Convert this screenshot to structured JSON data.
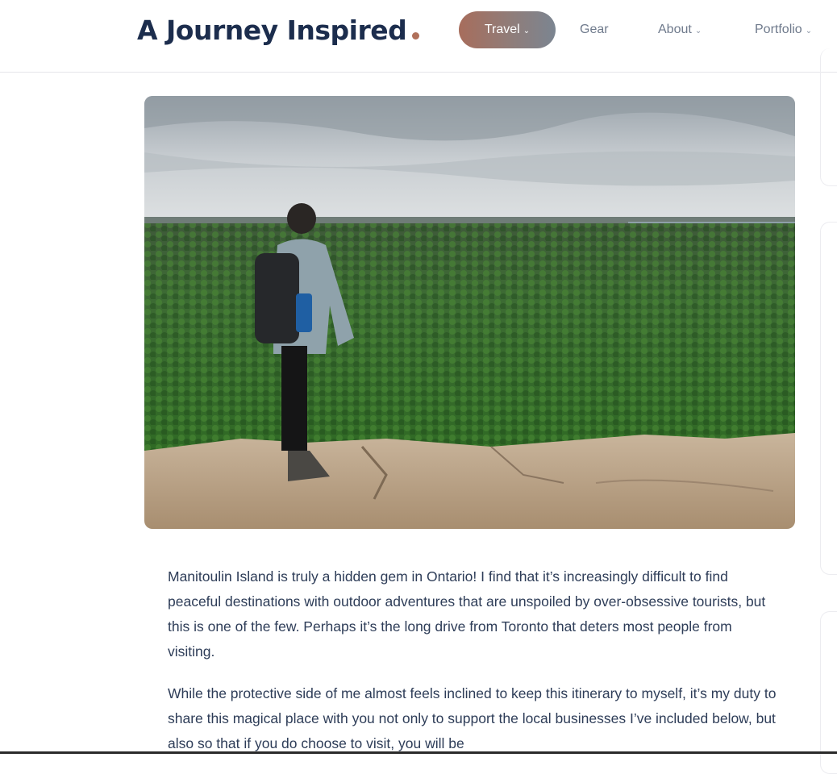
{
  "header": {
    "logo_text": "A Journey Inspired",
    "brand_color": "#1c2d4d",
    "accent_color": "#b0705a"
  },
  "nav": {
    "items": [
      {
        "label": "Travel",
        "active": true,
        "has_dropdown": true
      },
      {
        "label": "Gear",
        "active": false,
        "has_dropdown": false
      },
      {
        "label": "About",
        "active": false,
        "has_dropdown": true
      },
      {
        "label": "Portfolio",
        "active": false,
        "has_dropdown": true
      }
    ]
  },
  "hero": {
    "alt": "Hiker with backpack standing on rocky escarpment overlooking a green forest"
  },
  "article": {
    "paragraphs": [
      "Manitoulin Island is truly a hidden gem in Ontario! I find that it’s increasingly difficult to find peaceful destinations with outdoor adventures that are unspoiled by over-obsessive tourists, but this is one of the few. Perhaps it’s the long drive from Toronto that deters most people from visiting.",
      "While the protective side of me almost feels inclined to keep this itinerary to myself, it’s my duty to share this magical place with you not only to support the local businesses I’ve included below, but also so that if you do choose to visit, you will be"
    ]
  }
}
